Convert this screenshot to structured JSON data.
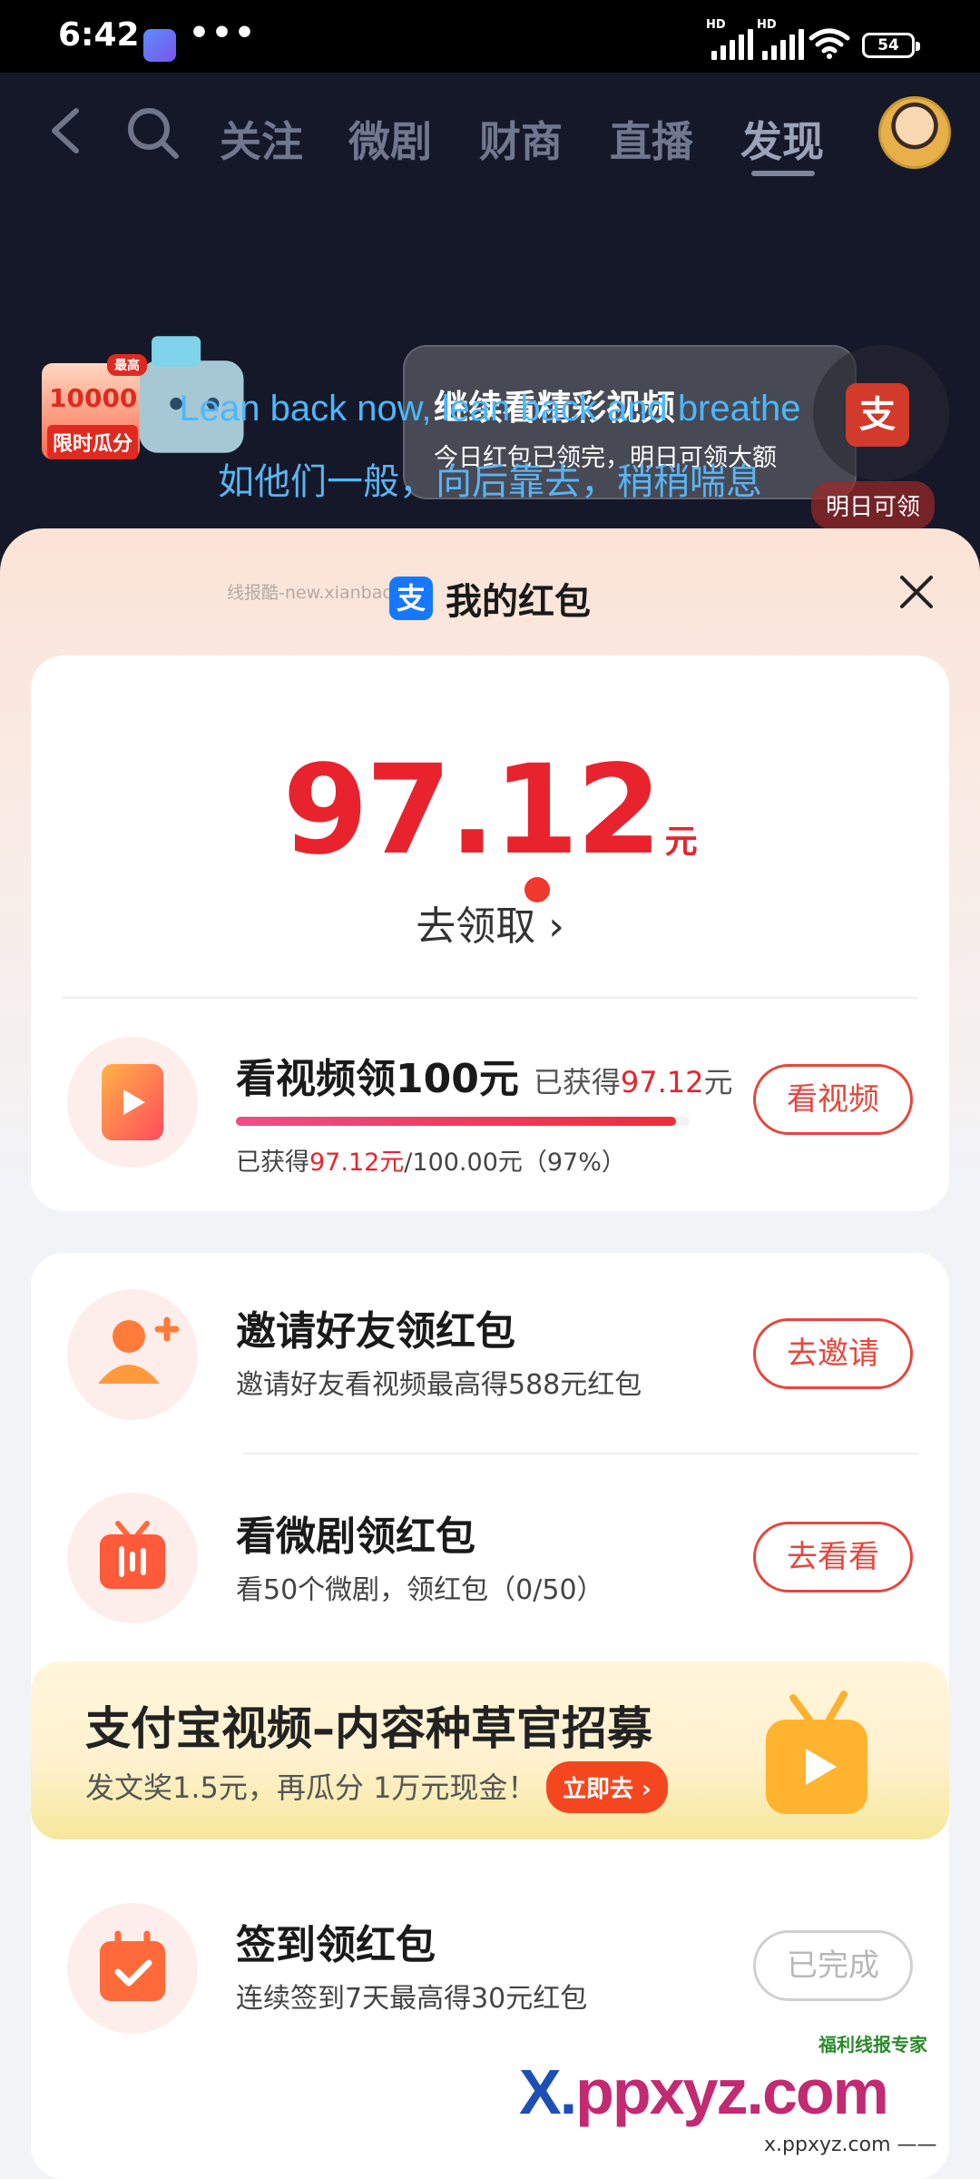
{
  "status_bar": {
    "time": "6:42",
    "dots": "•••",
    "hd1": "HD",
    "hd2": "HD",
    "battery": "54"
  },
  "nav": {
    "tabs": [
      "关注",
      "微剧",
      "财商",
      "直播",
      "发现"
    ],
    "active_tab": "发现"
  },
  "promo": {
    "tag": "最高",
    "amount": "10000",
    "label": "限时瓜分"
  },
  "toast": {
    "title": "继续看精彩视频",
    "subtitle": "今日红包已领完，明日可领大额"
  },
  "side_label": "明日可领",
  "subtitles": {
    "en": "Lean back now, lean back and breathe",
    "cn": "如他们一般，向后靠去，稍稍喘息"
  },
  "sheet": {
    "watermark": "线报酷-new.xianbao.fun",
    "title": "我的红包",
    "alipay_glyph": "支",
    "amount": "97.12",
    "amount_unit": "元",
    "claim": "去领取 ›"
  },
  "video_task": {
    "title": "看视频领100元",
    "earned_prefix": "已获得",
    "earned_value": "97.12",
    "earned_suffix": "元",
    "detail_prefix": "已获得",
    "detail_value": "97.12元",
    "detail_suffix": "/100.00元（97%）",
    "progress": 0.97,
    "button": "看视频"
  },
  "tasks": [
    {
      "title": "邀请好友领红包",
      "subtitle": "邀请好友看视频最高得588元红包",
      "button": "去邀请"
    },
    {
      "title": "看微剧领红包",
      "subtitle": "看50个微剧，领红包（0/50）",
      "button": "去看看"
    },
    {
      "title": "签到领红包",
      "subtitle": "连续签到7天最高得30元红包",
      "button": "已完成"
    }
  ],
  "ad": {
    "title": "支付宝视频–内容种草官招募",
    "subtitle": "发文奖1.5元，再瓜分 1万元现金！",
    "button": "立即去 ›"
  },
  "watermark_logo": {
    "x": "X.",
    "rest": "ppxyz.com",
    "sub": "x.ppxyz.com ——",
    "badge": "福利线报专家"
  },
  "colors": {
    "accent_red": "#e8232e",
    "alipay_blue": "#1678ff"
  }
}
